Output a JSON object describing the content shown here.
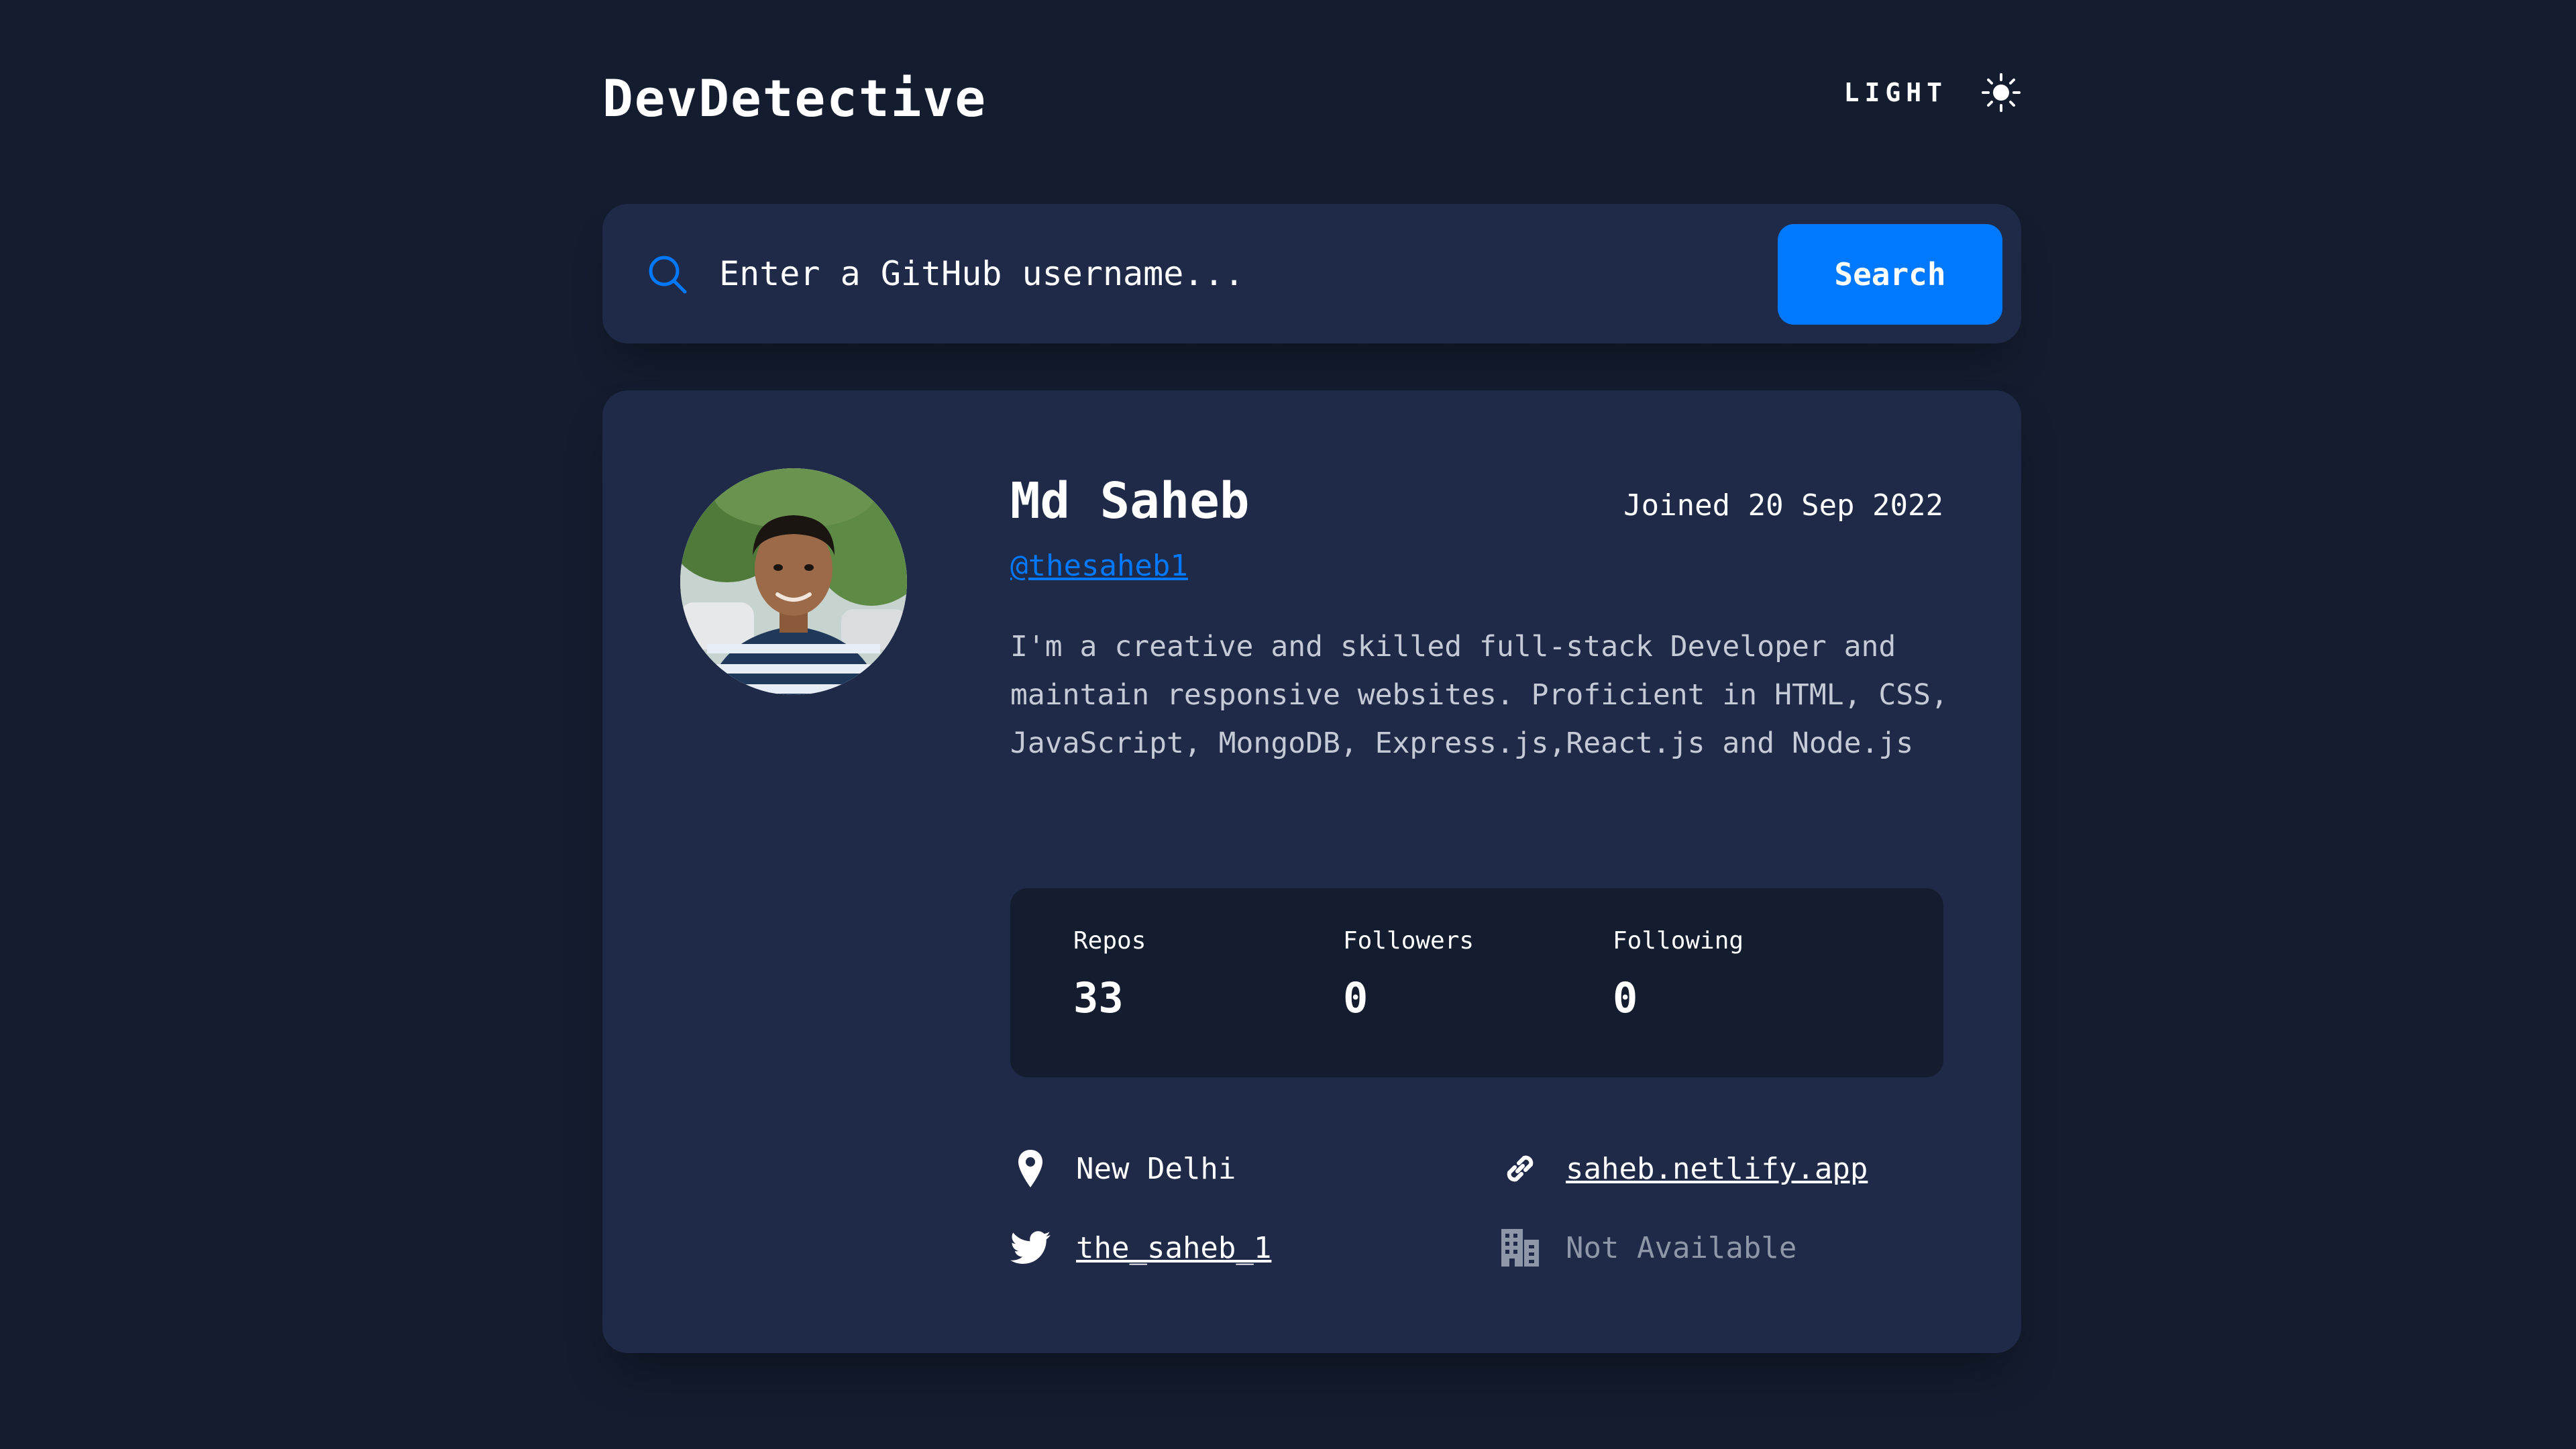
{
  "header": {
    "logo": "DevDetective",
    "theme_label": "LIGHT",
    "theme_icon": "sun-icon"
  },
  "search": {
    "placeholder": "Enter a GitHub username...",
    "value": "",
    "button_label": "Search",
    "icon": "search-icon"
  },
  "profile": {
    "name": "Md Saheb",
    "joined": "Joined 20 Sep 2022",
    "username": "@thesaheb1",
    "bio": "I'm a creative and skilled full-stack Developer and maintain responsive websites. Proficient in HTML, CSS, JavaScript, MongoDB, Express.js,React.js and Node.js",
    "stats": {
      "repos_label": "Repos",
      "repos": "33",
      "followers_label": "Followers",
      "followers": "0",
      "following_label": "Following",
      "following": "0"
    },
    "links": {
      "location": "New Delhi",
      "website": "saheb.netlify.app",
      "twitter": "the_saheb_1",
      "company": "Not Available"
    }
  },
  "colors": {
    "background": "#141d2f",
    "card": "#1e2a47",
    "accent": "#0079ff",
    "muted_text": "#8d97a8"
  }
}
